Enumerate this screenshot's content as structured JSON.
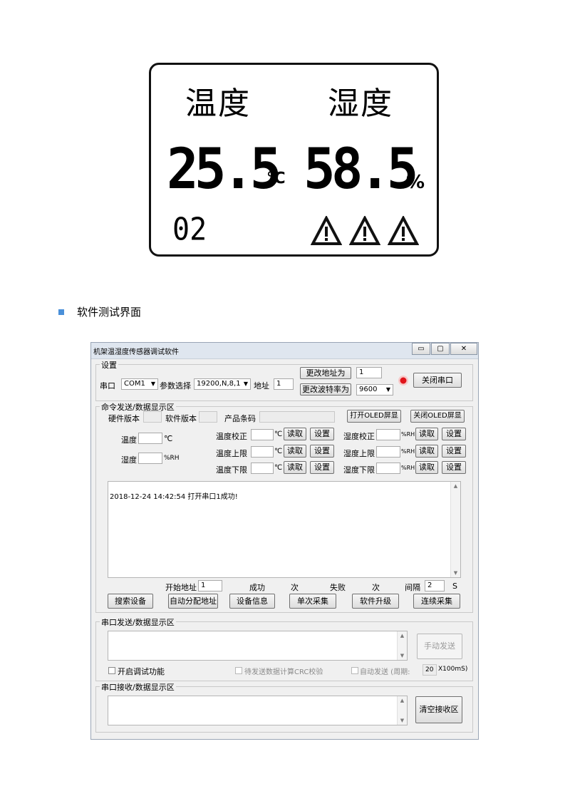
{
  "lcd": {
    "title_temp": "温度",
    "title_humid": "湿度",
    "temp_value": "25.5",
    "temp_unit": "℃",
    "humid_value": "58.5",
    "humid_unit": "%",
    "address": "02",
    "warning_icon": "warning-triangle-icon"
  },
  "bullet": {
    "text": "软件测试界面",
    "color": "#4a90d9"
  },
  "window": {
    "title": "机架温湿度传感器调试软件",
    "controls": {
      "minimize": "▭",
      "maximize": "▢",
      "close": "✕"
    },
    "settings": {
      "group_label": "设置",
      "port_label": "串口",
      "port_value": "COM1",
      "param_label": "参数选择",
      "param_value": "19200,N,8,1",
      "addr_label": "地址",
      "addr_value": "1",
      "change_addr_button": "更改地址为",
      "change_addr_value": "1",
      "change_baud_button": "更改波特率为",
      "baud_value": "9600",
      "close_port_button": "关闭串口",
      "status_led_color": "#e0141b"
    },
    "cmd": {
      "group_label": "命令发送/数据显示区",
      "hw_version_label": "硬件版本",
      "sw_version_label": "软件版本",
      "product_code_label": "产品条码",
      "open_oled_button": "打开OLED屏显",
      "close_oled_button": "关闭OLED屏显",
      "temp_label": "温度",
      "temp_unit": "℃",
      "humid_label": "湿度",
      "humid_unit": "%RH",
      "temp_rows": [
        {
          "label": "温度校正",
          "unit": "℃",
          "read": "读取",
          "set": "设置"
        },
        {
          "label": "温度上限",
          "unit": "℃",
          "read": "读取",
          "set": "设置"
        },
        {
          "label": "温度下限",
          "unit": "℃",
          "read": "读取",
          "set": "设置"
        }
      ],
      "humid_rows": [
        {
          "label": "湿度校正",
          "unit": "%RH",
          "read": "读取",
          "set": "设置"
        },
        {
          "label": "湿度上限",
          "unit": "%RH",
          "read": "读取",
          "set": "设置"
        },
        {
          "label": "湿度下限",
          "unit": "%RH",
          "read": "读取",
          "set": "设置"
        }
      ],
      "log_text": "2018-12-24 14:42:54 打开串口1成功!",
      "start_addr_label": "开始地址",
      "start_addr_value": "1",
      "success_label": "成功",
      "times_label_1": "次",
      "fail_label": "失败",
      "times_label_2": "次",
      "interval_label": "间隔",
      "interval_value": "2",
      "interval_unit": "S",
      "buttons": [
        "搜索设备",
        "自动分配地址",
        "设备信息",
        "单次采集",
        "软件升级",
        "连续采集"
      ]
    },
    "send": {
      "group_label": "串口发送/数据显示区",
      "manual_send_button": "手动发送",
      "debug_checkbox_label": "开启调试功能",
      "crc_checkbox_label": "待发送数据计算CRC校验",
      "auto_send_label": "自动发送 (周期:",
      "period_value": "20",
      "period_unit": "X100mS)"
    },
    "recv": {
      "group_label": "串口接收/数据显示区",
      "clear_button": "清空接收区"
    }
  }
}
